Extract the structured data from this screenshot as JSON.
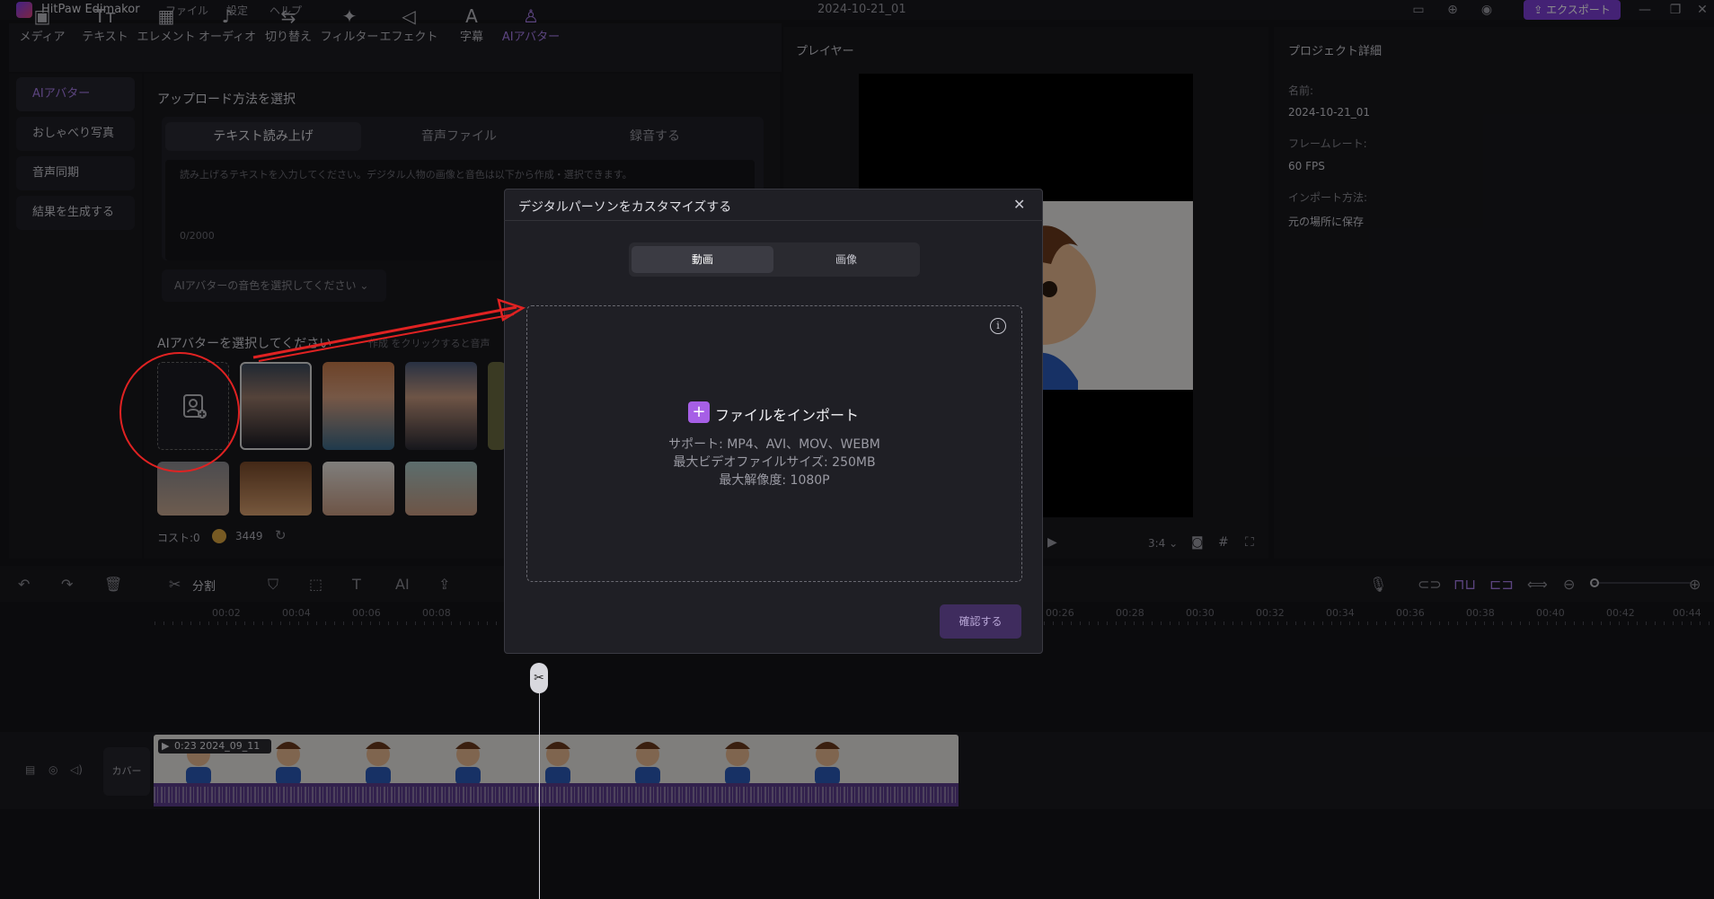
{
  "app": {
    "name": "HitPaw Edimakor",
    "project_title": "2024-10-21_01"
  },
  "menu": [
    "ファイル",
    "設定",
    "ヘルプ"
  ],
  "export_label": "エクスポート",
  "toolbar": [
    {
      "label": "メディア",
      "icon": "media-icon"
    },
    {
      "label": "テキスト",
      "icon": "text-icon"
    },
    {
      "label": "エレメント",
      "icon": "element-icon"
    },
    {
      "label": "オーディオ",
      "icon": "audio-icon"
    },
    {
      "label": "切り替え",
      "icon": "transition-icon"
    },
    {
      "label": "フィルター",
      "icon": "filter-icon"
    },
    {
      "label": "エフェクト",
      "icon": "effect-icon"
    },
    {
      "label": "字幕",
      "icon": "subtitle-icon"
    },
    {
      "label": "AIアバター",
      "icon": "ai-avatar-icon",
      "active": true
    }
  ],
  "sidebar": [
    "AIアバター",
    "おしゃべり写真",
    "音声同期",
    "結果を生成する"
  ],
  "left_panel": {
    "upload_title": "アップロード方法を選択",
    "tabs": [
      "テキスト読み上げ",
      "音声ファイル",
      "録音する"
    ],
    "textarea_placeholder": "読み上げるテキストを入力してください。デジタル人物の画像と音色は以下から作成・選択できます。",
    "char_count": "0/2000",
    "voice_select": "AIアバターの音色を選択してください",
    "avatar_title": "AIアバターを選択してください",
    "avatar_hint": "作成 をクリックすると音声",
    "cost_label": "コスト:0",
    "coin_value": "3449"
  },
  "player": {
    "title": "プレイヤー",
    "ratio": "3:4"
  },
  "details": {
    "title": "プロジェクト詳細",
    "name_label": "名前:",
    "name_value": "2024-10-21_01",
    "fps_label": "フレームレート:",
    "fps_value": "60 FPS",
    "import_label": "インポート方法:",
    "import_value": "元の場所に保存"
  },
  "timeline": {
    "split_label": "分割",
    "ticks_left": [
      "00:02",
      "00:04",
      "00:06",
      "00:08"
    ],
    "ticks_right": [
      "00:26",
      "00:28",
      "00:30",
      "00:32",
      "00:34",
      "00:36",
      "00:38",
      "00:40",
      "00:42",
      "00:44"
    ],
    "cover_label": "カバー",
    "clip_label": "0:23 2024_09_11"
  },
  "modal": {
    "title": "デジタルパーソンをカスタマイズする",
    "tabs": [
      "動画",
      "画像"
    ],
    "import_label": "ファイルをインポート",
    "support": "サポート: MP4、AVI、MOV、WEBM",
    "max_size": "最大ビデオファイルサイズ: 250MB",
    "max_res": "最大解像度: 1080P",
    "confirm": "確認する"
  },
  "colors": {
    "accent": "#a77ce8",
    "annotation": "#e02222",
    "export_bg": "#7c3fd6"
  }
}
